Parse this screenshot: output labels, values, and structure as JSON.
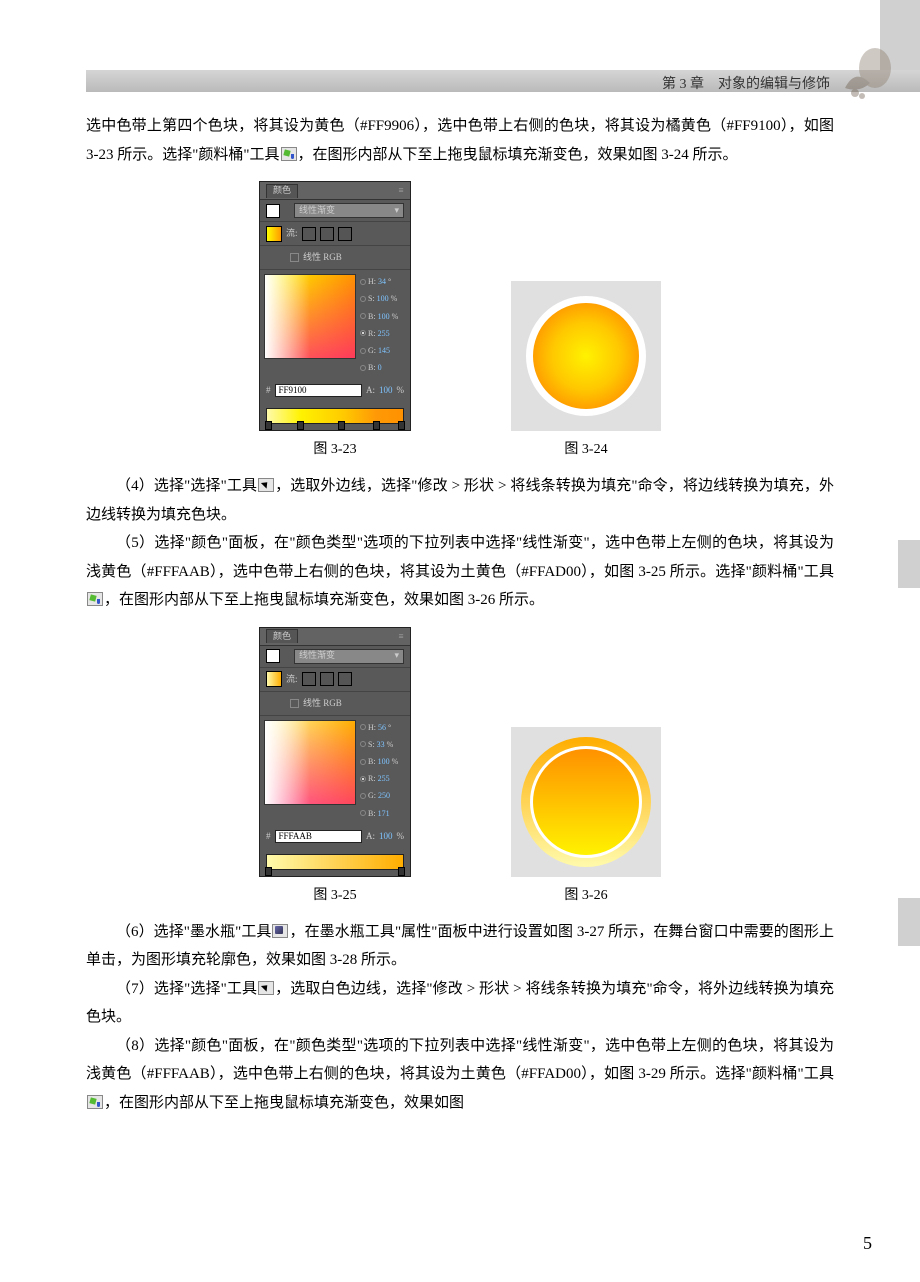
{
  "header": {
    "title": "第 3 章　对象的编辑与修饰"
  },
  "intro": {
    "line1": "选中色带上第四个色块，将其设为黄色（#FF9906），选中色带上右侧的色块，将其设为橘黄色（#FF9100），如图 3-23 所示。选择\"颜料桶\"工具",
    "line2": "，在图形内部从下至上拖曳鼠标填充渐变色，效果如图 3-24 所示。"
  },
  "panel1": {
    "tab": "颜色",
    "gradientType": "线性渐变",
    "flowLabel": "流:",
    "rgbLabel": "线性 RGB",
    "h": {
      "label": "H:",
      "val": "34",
      "unit": "°"
    },
    "s": {
      "label": "S:",
      "val": "100",
      "unit": "%"
    },
    "b": {
      "label": "B:",
      "val": "100",
      "unit": "%"
    },
    "r": {
      "label": "R:",
      "val": "255"
    },
    "g": {
      "label": "G:",
      "val": "145"
    },
    "bb": {
      "label": "B:",
      "val": "0"
    },
    "hexLabel": "#",
    "hex": "FF9100",
    "a": {
      "label": "A:",
      "val": "100",
      "unit": "%"
    }
  },
  "captions": {
    "fig23": "图 3-23",
    "fig24": "图 3-24",
    "fig25": "图 3-25",
    "fig26": "图 3-26"
  },
  "step4": {
    "a": "（4）选择\"选择\"工具",
    "b": "，选取外边线，选择\"修改 > 形状 > 将线条转换为填充\"命令，将边线转换为填充，外边线转换为填充色块。"
  },
  "step5": {
    "a": "（5）选择\"颜色\"面板，在\"颜色类型\"选项的下拉列表中选择\"线性渐变\"，选中色带上左侧的色块，将其设为浅黄色（#FFFAAB），选中色带上右侧的色块，将其设为土黄色（#FFAD00），如图 3-25 所示。选择\"颜料桶\"工具",
    "b": "，在图形内部从下至上拖曳鼠标填充渐变色，效果如图 3-26 所示。"
  },
  "panel2": {
    "tab": "颜色",
    "gradientType": "线性渐变",
    "flowLabel": "流:",
    "rgbLabel": "线性 RGB",
    "h": {
      "label": "H:",
      "val": "56",
      "unit": "°"
    },
    "s": {
      "label": "S:",
      "val": "33",
      "unit": "%"
    },
    "b": {
      "label": "B:",
      "val": "100",
      "unit": "%"
    },
    "r": {
      "label": "R:",
      "val": "255"
    },
    "g": {
      "label": "G:",
      "val": "250"
    },
    "bb": {
      "label": "B:",
      "val": "171"
    },
    "hexLabel": "#",
    "hex": "FFFAAB",
    "a": {
      "label": "A:",
      "val": "100",
      "unit": "%"
    }
  },
  "step6": {
    "a": "（6）选择\"墨水瓶\"工具",
    "b": "，在墨水瓶工具\"属性\"面板中进行设置如图 3-27 所示，在舞台窗口中需要的图形上单击，为图形填充轮廓色，效果如图 3-28 所示。"
  },
  "step7": {
    "a": "（7）选择\"选择\"工具",
    "b": "，选取白色边线，选择\"修改 > 形状 > 将线条转换为填充\"命令，将外边线转换为填充色块。"
  },
  "step8": {
    "a": "（8）选择\"颜色\"面板，在\"颜色类型\"选项的下拉列表中选择\"线性渐变\"，选中色带上左侧的色块，将其设为浅黄色（#FFFAAB），选中色带上右侧的色块，将其设为土黄色（#FFAD00），如图 3-29 所示。选择\"颜料桶\"工具",
    "b": "，在图形内部从下至上拖曳鼠标填充渐变色，效果如图"
  },
  "pageNumber": "5"
}
